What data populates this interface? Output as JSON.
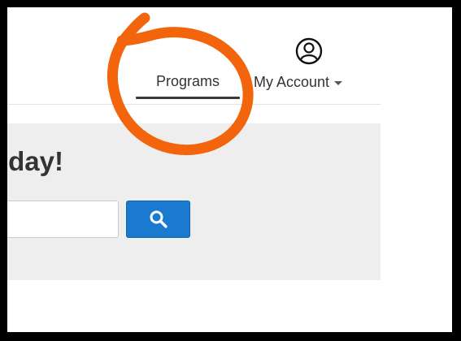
{
  "nav": {
    "programs_label": "Programs",
    "account_label": "My Account"
  },
  "hero": {
    "title": "today!",
    "search_placeholder": "",
    "search_value": ""
  },
  "icons": {
    "account": "user-circle-icon",
    "search": "search-icon",
    "caret": "caret-down-icon"
  },
  "colors": {
    "annotation": "#f2650c",
    "search_button": "#1a7ad0",
    "hero_background": "#eeeeee",
    "frame_border": "#000000"
  }
}
